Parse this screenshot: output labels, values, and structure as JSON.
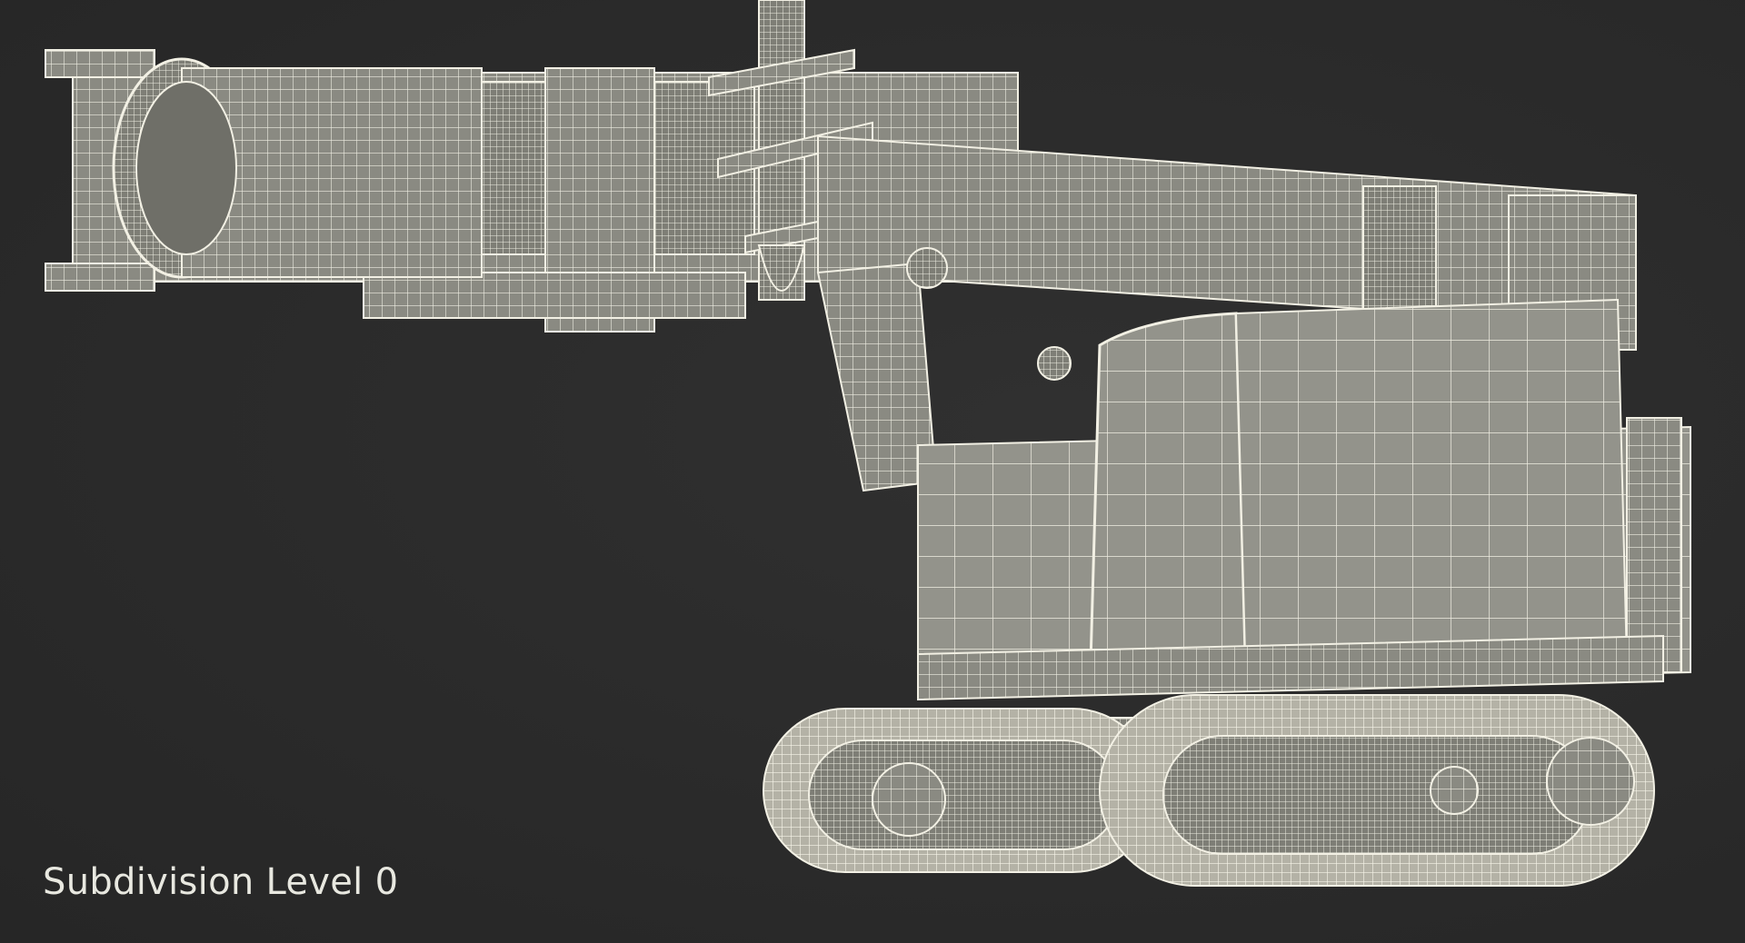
{
  "viewport": {
    "caption": "Subdivision Level 0",
    "background_color": "#2b2b2b",
    "model_fill_color": "#8c8c84",
    "wire_color": "#f2f0e4"
  }
}
